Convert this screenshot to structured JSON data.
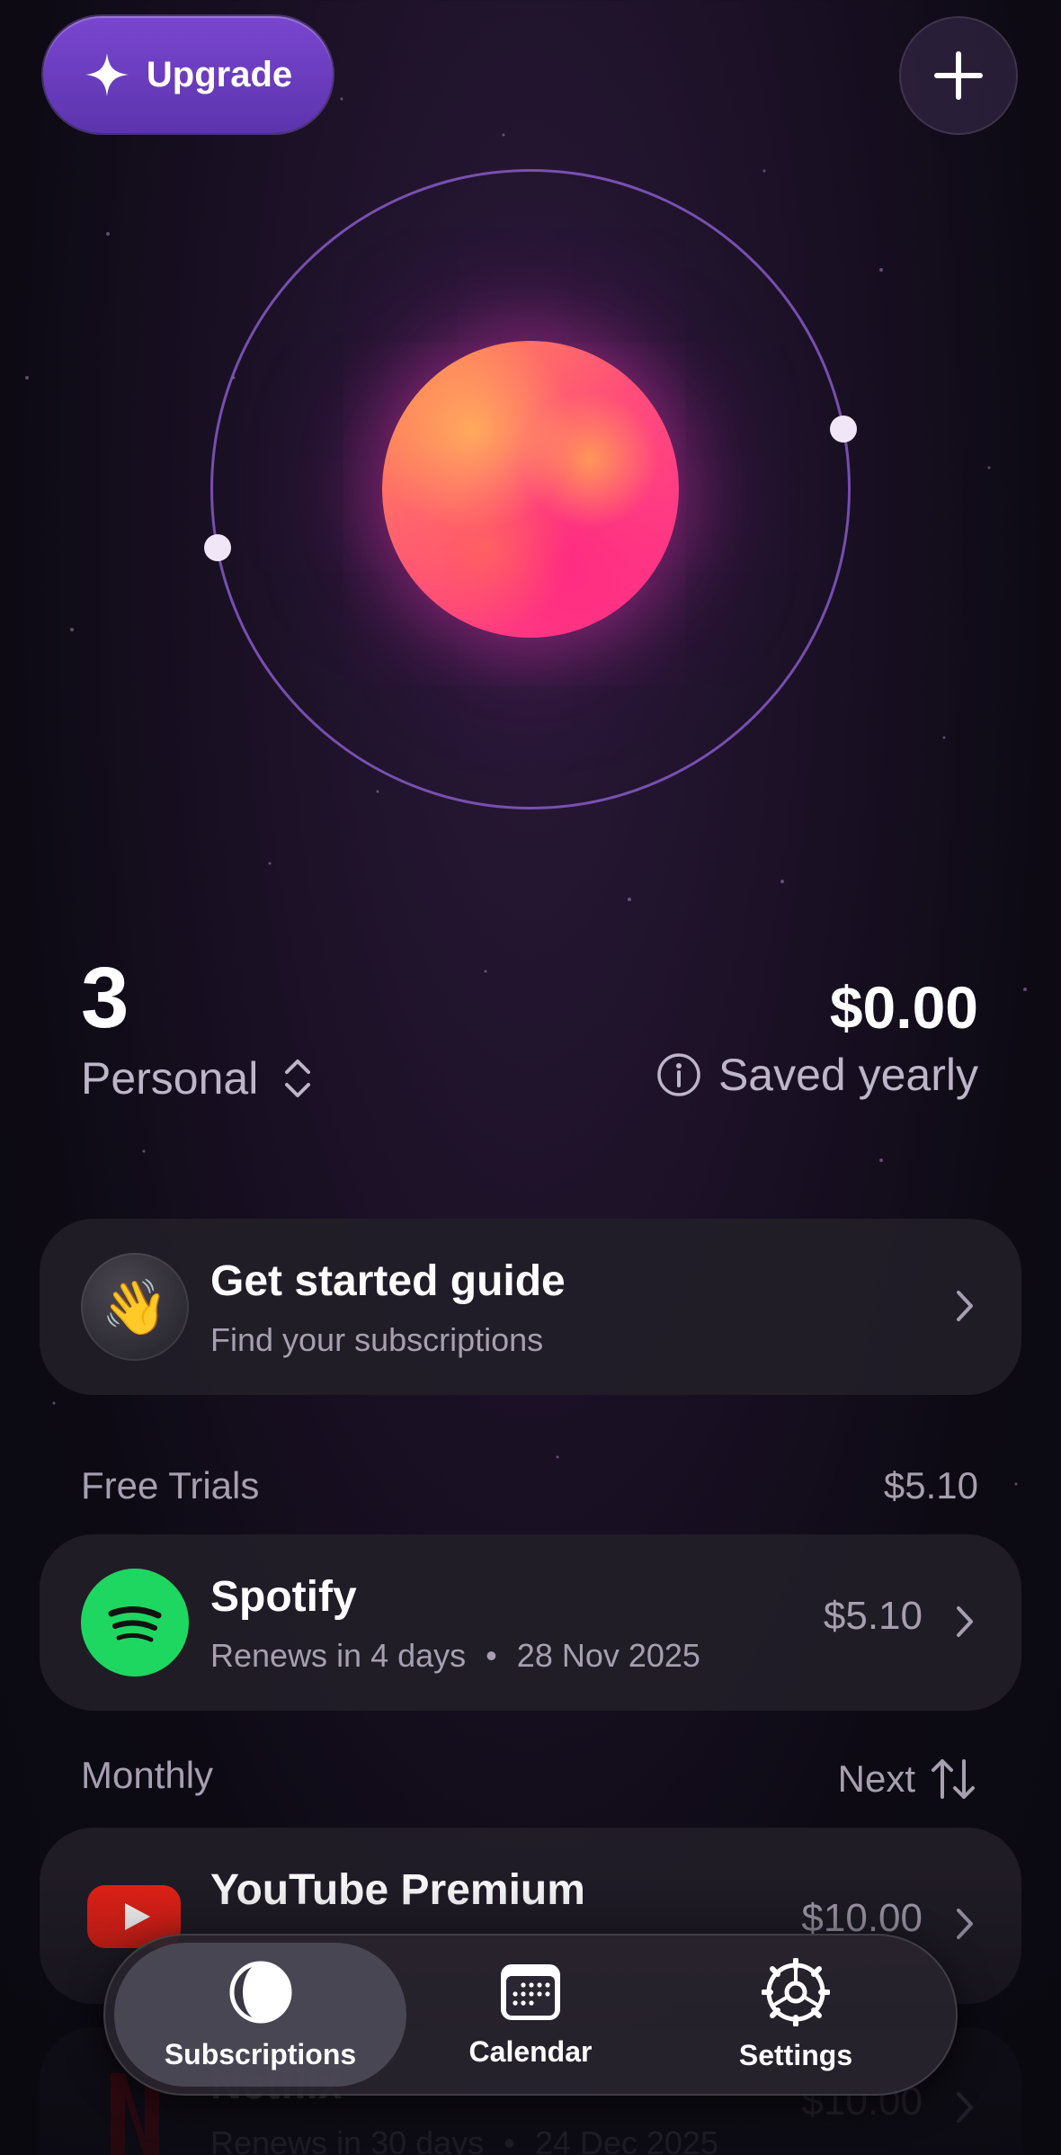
{
  "header": {
    "upgrade_label": "Upgrade",
    "add_icon": "plus-icon"
  },
  "stats": {
    "count": "3",
    "profile_label": "Personal",
    "amount": "$0.00",
    "saved_label": "Saved yearly"
  },
  "guide": {
    "title": "Get started guide",
    "subtitle": "Find your subscriptions",
    "emoji": "👋"
  },
  "sections": {
    "free_trials": {
      "label": "Free Trials",
      "total": "$5.10"
    },
    "monthly": {
      "label": "Monthly",
      "sort_label": "Next"
    }
  },
  "subscriptions": [
    {
      "name": "Spotify",
      "renew_text": "Renews in 4 days",
      "date": "28 Nov 2025",
      "price": "$5.10",
      "logo_color": "#1ed760"
    },
    {
      "name": "YouTube Premium",
      "renew_text": "",
      "date": "",
      "price": "$10.00",
      "logo_color": "#e62117"
    },
    {
      "name": "Netflix",
      "renew_text": "Renews in 30 days",
      "date": "24 Dec 2025",
      "price": "$10.00",
      "logo_color": "#e50914"
    }
  ],
  "tabs": [
    {
      "label": "Subscriptions",
      "icon": "half-moon-icon",
      "active": true
    },
    {
      "label": "Calendar",
      "icon": "calendar-icon",
      "active": false
    },
    {
      "label": "Settings",
      "icon": "gear-icon",
      "active": false
    }
  ],
  "colors": {
    "accent": "#6c3dbf",
    "background": "#0d0a14",
    "card": "#221e28",
    "muted_text": "#a79fb0"
  }
}
